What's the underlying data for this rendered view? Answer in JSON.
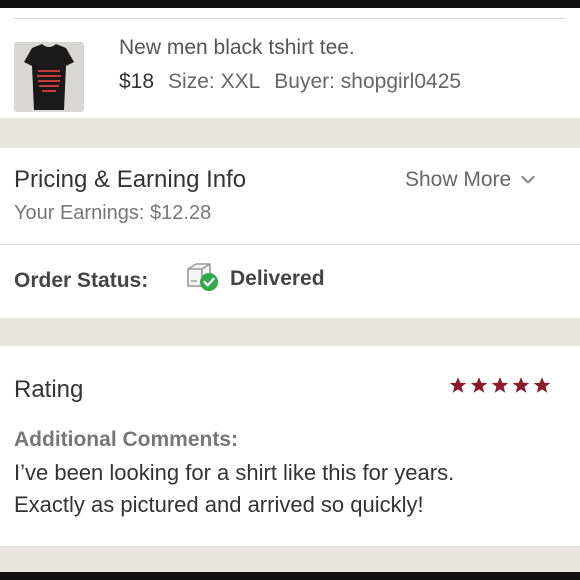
{
  "item": {
    "title": "New men black tshirt tee.",
    "price": "$18",
    "size": "Size: XXL",
    "buyer": "Buyer: shopgirl0425",
    "thumb_icon": "tshirt-thumbnail"
  },
  "pricing": {
    "title": "Pricing & Earning Info",
    "earnings": "Your Earnings: $12.28",
    "show_more": "Show More",
    "chevron_icon": "chevron-down-icon"
  },
  "order": {
    "label": "Order Status:",
    "status": "Delivered",
    "status_icon": "delivered-package-icon",
    "status_color": "#2eaa4a"
  },
  "rating": {
    "title": "Rating",
    "stars": 5,
    "star_color": "#8b1a2b",
    "comments_label": "Additional Comments:",
    "comment_line1": "I’ve been looking for a shirt like this for years.",
    "comment_line2": "Exactly as pictured and arrived so quickly!"
  },
  "colors": {
    "background": "#e9e6e1",
    "card": "#ffffff",
    "topbar": "#111111"
  }
}
